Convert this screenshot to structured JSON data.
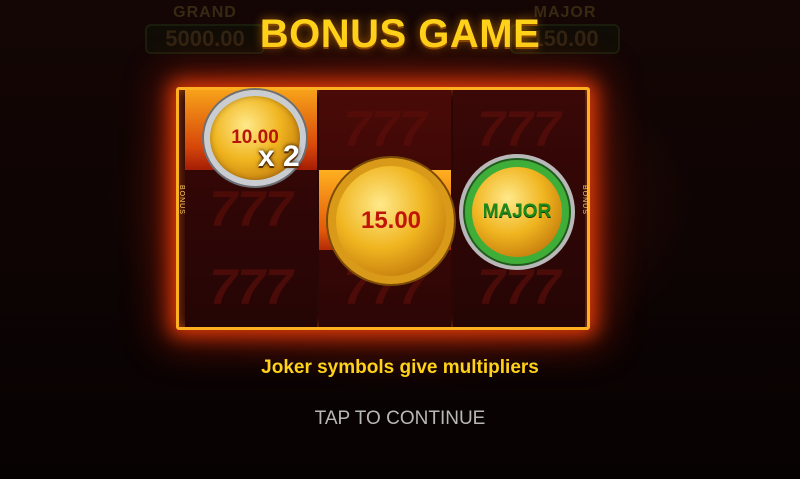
{
  "background": {
    "jackpots": [
      {
        "label": "GRAND",
        "value": "5000.00"
      },
      {
        "label": "MAJOR",
        "value": "150.00"
      }
    ]
  },
  "dialog": {
    "title": "BONUS GAME",
    "subtitle": "Joker symbols give multipliers",
    "continue_label": "TAP TO CONTINUE"
  },
  "reels": {
    "side_label": "BONUS",
    "background_symbol": "777",
    "coins": [
      {
        "value": "10.00",
        "style": "silver",
        "multiplier": "x 2"
      },
      {
        "value": "15.00",
        "style": "gold"
      },
      {
        "value": "MAJOR",
        "style": "green"
      }
    ]
  },
  "colors": {
    "title": "#ffd21a",
    "frame": "#ffb020",
    "glow": "#ff460a",
    "continue_text": "#b8b8b8"
  }
}
